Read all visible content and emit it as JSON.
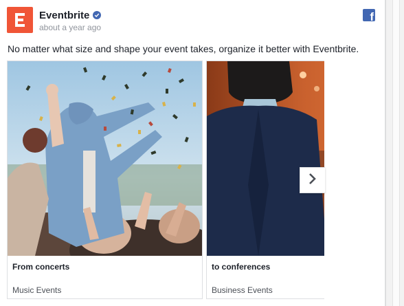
{
  "post": {
    "page_name": "Eventbrite",
    "timestamp": "about a year ago",
    "text": "No matter what size and shape your event takes, organize it better with Eventbrite."
  },
  "carousel": {
    "cards": [
      {
        "title": "From concerts",
        "subtitle": "Music Events"
      },
      {
        "title": "to conferences",
        "subtitle": "Business Events"
      }
    ]
  },
  "icons": {
    "logo": "eventbrite-logo",
    "verified": "verified-badge-icon",
    "platform": "facebook-icon",
    "next": "chevron-right-icon"
  },
  "colors": {
    "brand": "#f05537",
    "facebook_blue": "#4267b2",
    "text": "#1d2129",
    "muted": "#90949c"
  }
}
